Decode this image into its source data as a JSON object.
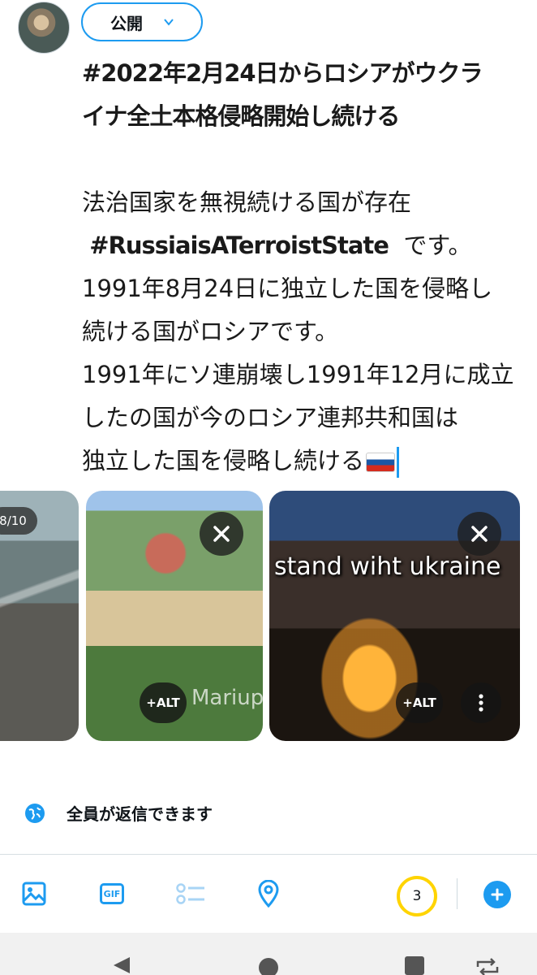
{
  "composer": {
    "audience_label": "公開",
    "avatar_name": "avatar",
    "lines": [
      "#2022年2月24日からロシアがウクラ",
      "イナ全土本格侵略開始し続ける",
      "",
      "法治国家を無視続ける国が存在",
      "#RussiaisATerroistState",
      "です。",
      "1991年8月24日に独立した国を侵略し",
      "続ける国がロシアです。",
      "1991年にソ連崩壊し1991年12月に成立",
      "したの国が今のロシア連邦共和国は",
      "独立した国を侵略し続ける"
    ]
  },
  "media": {
    "counter": "8/10",
    "alt_label": "+ALT",
    "overlay_caption": "stand wiht ukraine",
    "watermark": "Mariup"
  },
  "reply_setting": {
    "label": "全員が返信できます",
    "icon": "globe-icon"
  },
  "toolbar": {
    "icons": [
      "image-icon",
      "gif-icon",
      "poll-icon",
      "location-icon"
    ],
    "gif_label": "GIF",
    "char_count": "3",
    "add_icon": "plus-icon"
  },
  "colors": {
    "accent": "#1d9bf0",
    "counter_ring": "#ffd400"
  },
  "navbar": {
    "icons": [
      "back-icon",
      "home-icon",
      "recents-icon",
      "rotate-icon"
    ]
  }
}
